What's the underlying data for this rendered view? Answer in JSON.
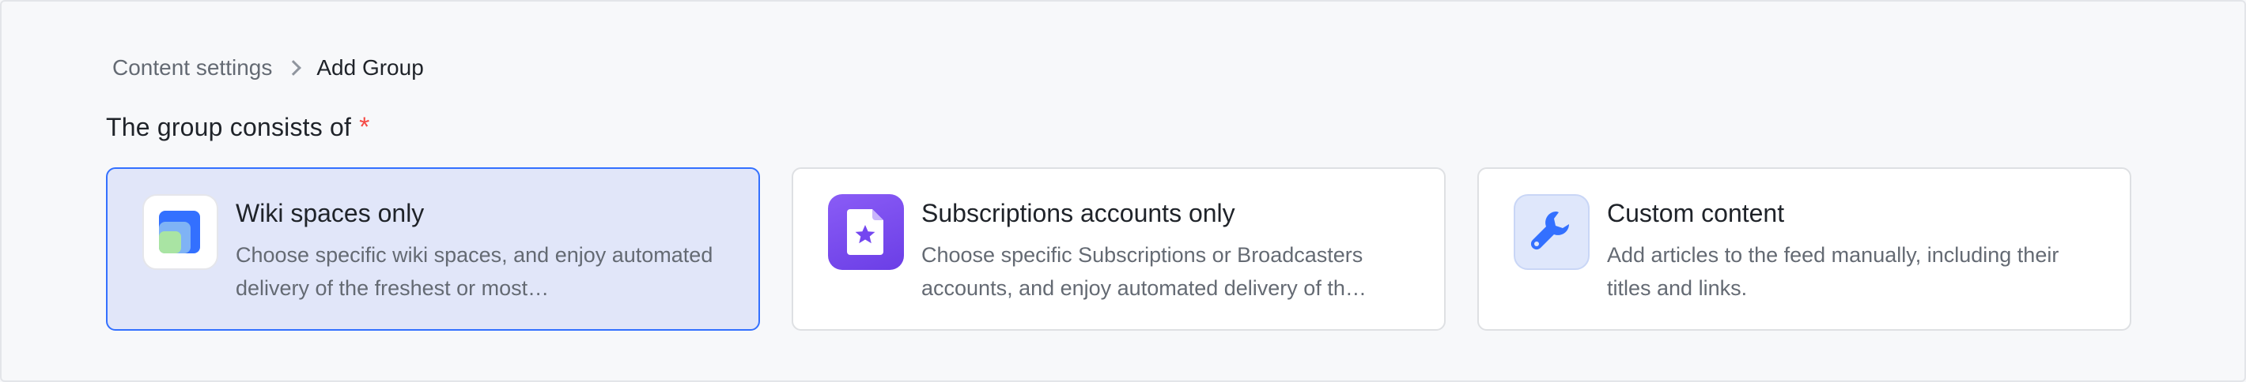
{
  "breadcrumb": {
    "parent": "Content settings",
    "current": "Add Group"
  },
  "section": {
    "title": "The group consists of",
    "required_mark": "*"
  },
  "options": [
    {
      "title": "Wiki spaces only",
      "description": "Choose specific wiki spaces, and enjoy automated delivery of the freshest or most…",
      "icon": "wiki-spaces-icon",
      "selected": true
    },
    {
      "title": "Subscriptions accounts only",
      "description": "Choose specific Subscriptions or Broadcasters accounts, and enjoy automated delivery of th…",
      "icon": "subscriptions-icon",
      "selected": false
    },
    {
      "title": "Custom content",
      "description": "Add articles to the feed manually, including their titles and links.",
      "icon": "wrench-icon",
      "selected": false
    }
  ],
  "colors": {
    "accent": "#3370ff",
    "selected_bg": "#e1e6f9",
    "required": "#f54a45",
    "subscriptions_icon": "#7447f0",
    "wrench_icon": "#3370ff"
  }
}
